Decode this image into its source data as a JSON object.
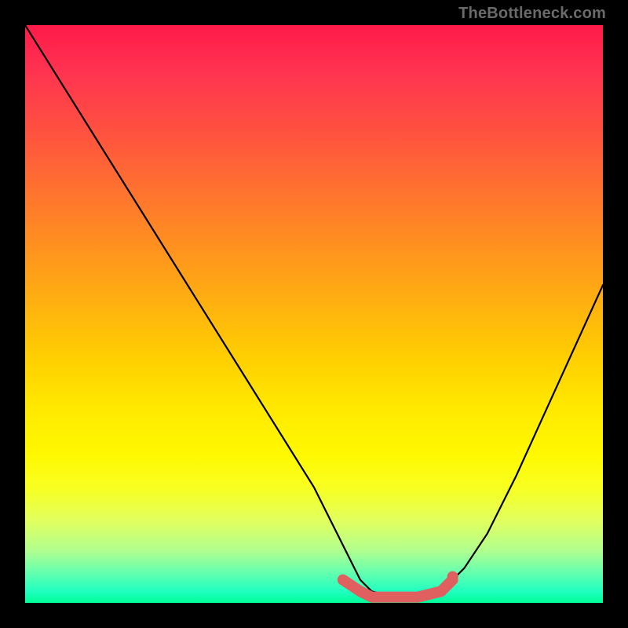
{
  "watermark": "TheBottleneck.com",
  "chart_data": {
    "type": "line",
    "title": "",
    "xlabel": "",
    "ylabel": "",
    "xlim": [
      0,
      100
    ],
    "ylim": [
      0,
      100
    ],
    "series": [
      {
        "name": "bottleneck-curve",
        "x": [
          0,
          10,
          20,
          30,
          40,
          50,
          55,
          58,
          60,
          64,
          68,
          72,
          76,
          80,
          85,
          90,
          95,
          100
        ],
        "y": [
          100,
          84,
          68,
          52,
          36,
          20,
          10,
          4,
          2,
          1,
          1,
          2,
          6,
          12,
          22,
          33,
          44,
          55
        ],
        "color": "#000000"
      },
      {
        "name": "optimal-highlight",
        "x": [
          55,
          58,
          60,
          64,
          68,
          72,
          74
        ],
        "y": [
          4,
          2,
          1,
          1,
          1,
          2,
          4
        ],
        "color": "#e06060"
      }
    ]
  }
}
